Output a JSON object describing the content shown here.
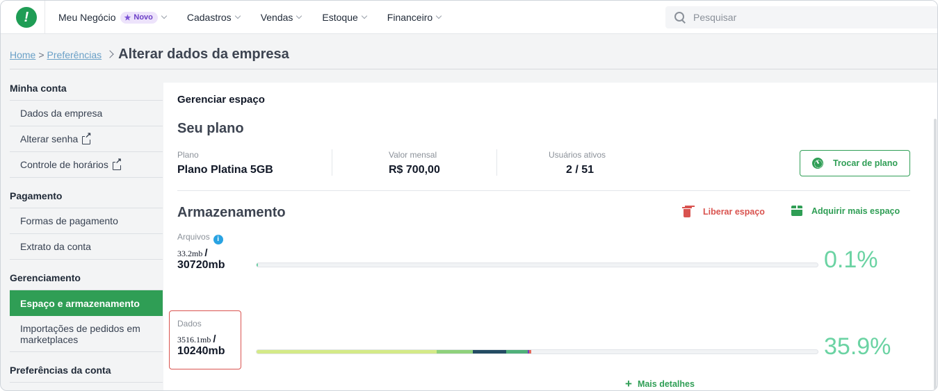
{
  "nav": {
    "items": [
      {
        "label": "Meu Negócio",
        "badge": "Novo"
      },
      {
        "label": "Cadastros"
      },
      {
        "label": "Vendas"
      },
      {
        "label": "Estoque"
      },
      {
        "label": "Financeiro"
      }
    ],
    "search_placeholder": "Pesquisar"
  },
  "breadcrumb": {
    "home": "Home",
    "sep": ">",
    "prefs": "Preferências",
    "title": "Alterar dados da empresa"
  },
  "sidebar": {
    "minha_conta": "Minha conta",
    "dados_empresa": "Dados da empresa",
    "alterar_senha": "Alterar senha",
    "controle_horarios": "Controle de horários",
    "pagamento": "Pagamento",
    "formas_pagamento": "Formas de pagamento",
    "extrato": "Extrato da conta",
    "gerenciamento": "Gerenciamento",
    "espaco": "Espaço e armazenamento",
    "importacoes": "Importações de pedidos em marketplaces",
    "preferencias_conta": "Preferências da conta"
  },
  "main": {
    "section_title": "Gerenciar espaço",
    "plan_title": "Seu plano",
    "plano_label": "Plano",
    "plano_value": "Plano Platina 5GB",
    "valor_label": "Valor mensal",
    "valor_value": "R$ 700,00",
    "usuarios_label": "Usuários ativos",
    "usuarios_value": "2 / 51",
    "trocar_plano": "Trocar de plano",
    "storage_title": "Armazenamento",
    "liberar": "Liberar espaço",
    "adquirir": "Adquirir mais espaço",
    "arquivos": {
      "label": "Arquivos",
      "used": "33.2mb",
      "slash": "/",
      "total": "30720mb",
      "percent_text": "0.1%",
      "fraction": 0.001,
      "segments": [
        {
          "fraction": 0.001,
          "color": "#6bd3a3"
        }
      ]
    },
    "dados": {
      "label": "Dados",
      "used": "3516.1mb",
      "slash": "/",
      "total": "10240mb",
      "percent_text": "35.9%",
      "fraction": 0.359,
      "segments": [
        {
          "fraction": 0.321,
          "color": "#d4ea88"
        },
        {
          "fraction": 0.064,
          "color": "#8fd17c"
        },
        {
          "fraction": 0.06,
          "color": "#244c63"
        },
        {
          "fraction": 0.038,
          "color": "#4fb07a"
        },
        {
          "fraction": 0.003,
          "color": "#7a3cc0"
        },
        {
          "fraction": 0.003,
          "color": "#e46a5c"
        }
      ]
    },
    "mais_detalhes": "Mais detalhes"
  },
  "colors": {
    "brand_green": "#2f9e55",
    "danger": "#d9534f",
    "percent": "#6bd3a3"
  }
}
